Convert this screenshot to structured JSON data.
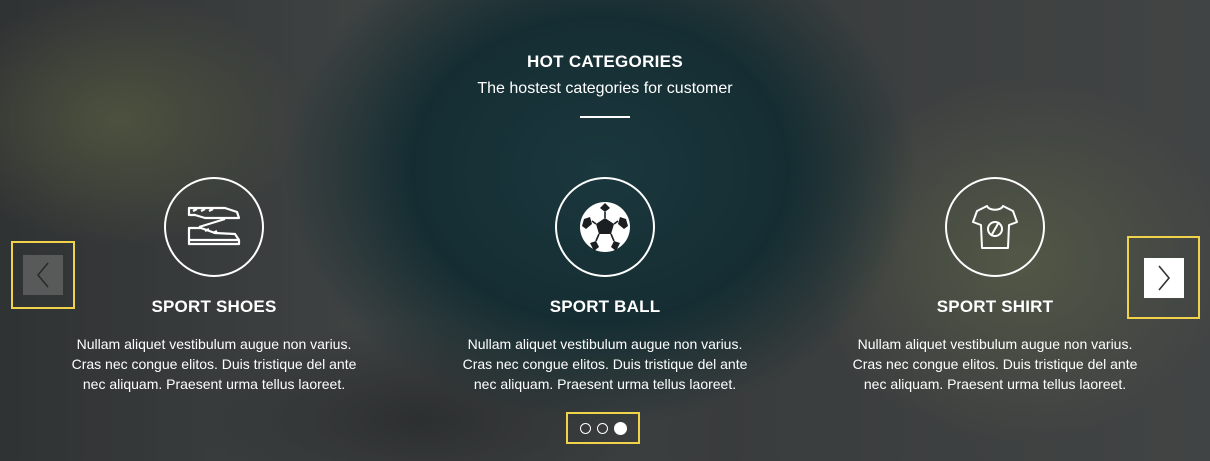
{
  "section": {
    "title": "HOT CATEGORIES",
    "subtitle": "The hostest categories for customer"
  },
  "categories": [
    {
      "title": "SPORT SHOES",
      "icon": "shoes-icon",
      "description": "Nullam aliquet vestibulum augue non varius. Cras nec congue elitos. Duis tristique del ante nec aliquam. Praesent urma tellus laoreet."
    },
    {
      "title": "SPORT BALL",
      "icon": "soccer-ball-icon",
      "description": "Nullam aliquet vestibulum augue non varius. Cras nec congue elitos. Duis tristique del ante nec aliquam. Praesent urma tellus laoreet."
    },
    {
      "title": "SPORT SHIRT",
      "icon": "shirt-icon",
      "description": "Nullam aliquet vestibulum augue non varius. Cras nec congue elitos. Duis tristique del ante nec aliquam. Praesent urma tellus laoreet."
    }
  ],
  "carousel": {
    "slide_count": 3,
    "active_slide": 3,
    "prev_icon": "chevron-left-icon",
    "next_icon": "chevron-right-icon"
  },
  "colors": {
    "highlight": "#f0d34a",
    "text": "#ffffff"
  }
}
